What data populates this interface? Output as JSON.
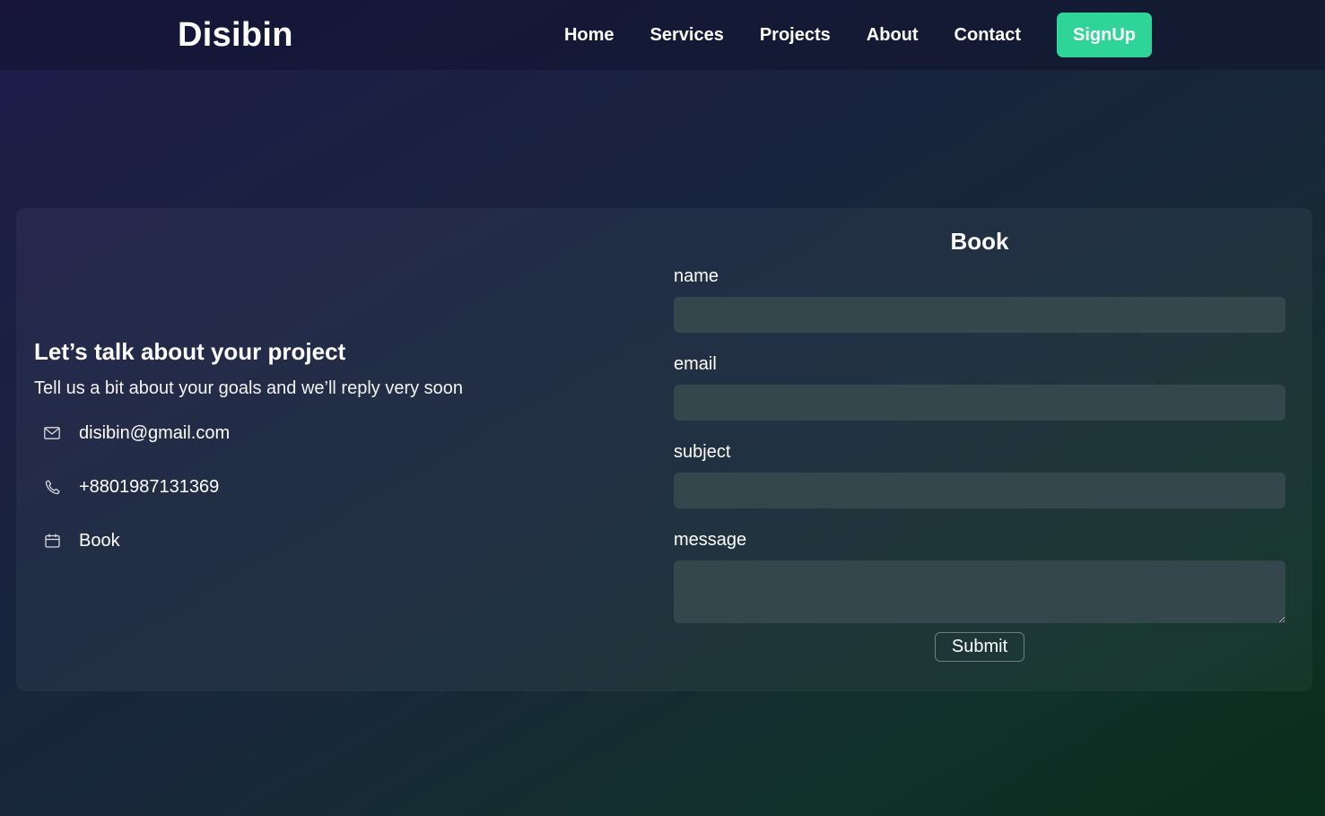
{
  "brand": "Disibin",
  "nav": {
    "links": [
      "Home",
      "Services",
      "Projects",
      "About",
      "Contact"
    ],
    "signup_label": "SignUp"
  },
  "contact": {
    "headline": "Let’s talk about your project",
    "tagline": "Tell us a bit about your goals and we’ll reply very soon",
    "email": "disibin@gmail.com",
    "phone": "+8801987131369",
    "book": "Book"
  },
  "form": {
    "title": "Book",
    "name_label": "name",
    "email_label": "email",
    "subject_label": "subject",
    "message_label": "message",
    "submit_label": "Submit"
  },
  "colors": {
    "accent": "#2fd598",
    "input_bg": "#34474c"
  },
  "icons": {
    "email": "envelope-icon",
    "phone": "phone-icon",
    "book": "calendar-icon"
  }
}
